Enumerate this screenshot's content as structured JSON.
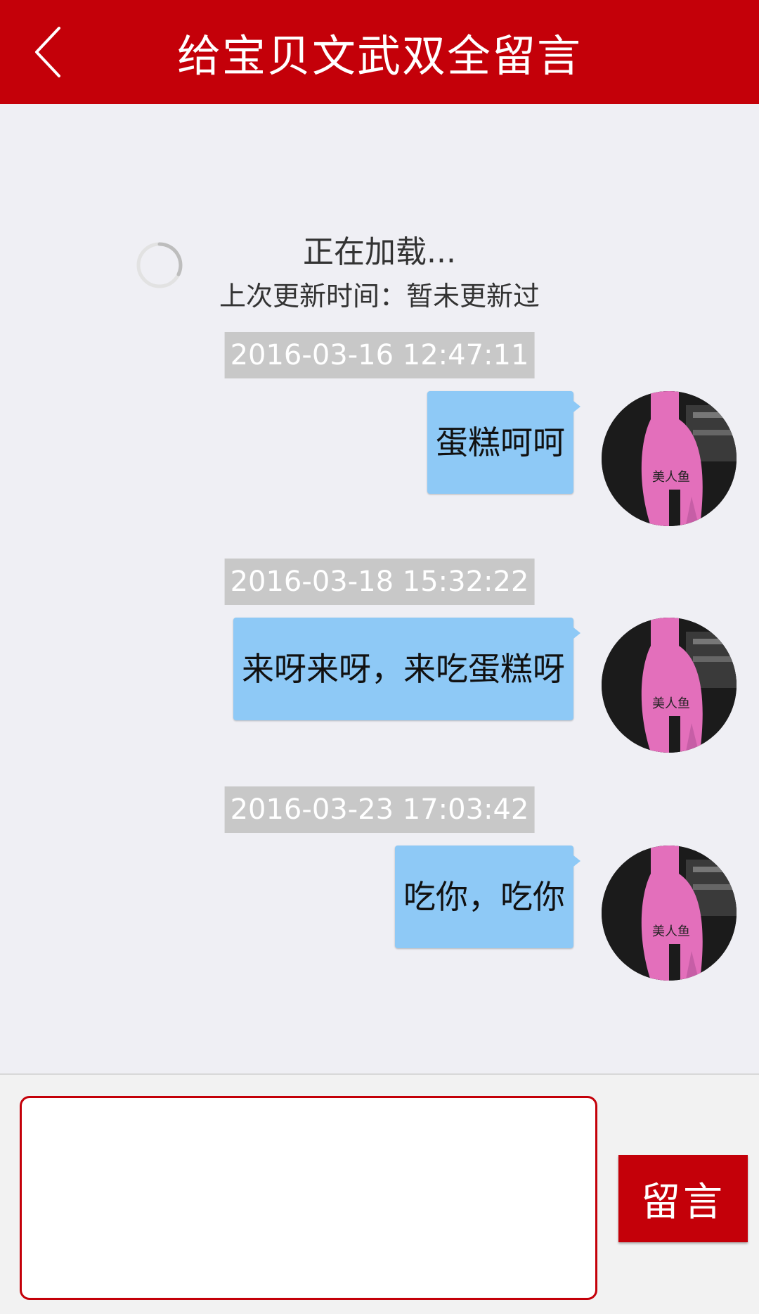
{
  "header": {
    "title": "给宝贝文武双全留言",
    "back_icon": "chevron-left-icon"
  },
  "loading": {
    "status": "正在加载...",
    "last_update": "上次更新时间：暂未更新过",
    "spinner_icon": "spinner-icon"
  },
  "messages": [
    {
      "timestamp": "2016-03-16 12:47:11",
      "text": "蛋糕呵呵"
    },
    {
      "timestamp": "2016-03-18 15:32:22",
      "text": "来呀来呀，来吃蛋糕呀"
    },
    {
      "timestamp": "2016-03-23 17:03:42",
      "text": "吃你，吃你"
    }
  ],
  "composer": {
    "input_value": "",
    "submit_label": "留言"
  },
  "colors": {
    "brand_red": "#c40009",
    "bubble_blue": "#8ec9f6",
    "timestamp_gray": "#c8c8c8",
    "background": "#efeff4"
  }
}
